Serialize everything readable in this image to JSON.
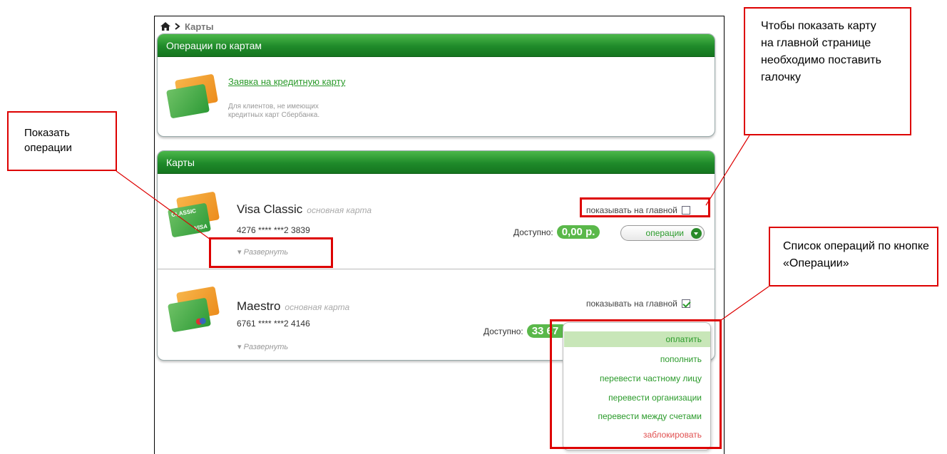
{
  "breadcrumb": {
    "current": "Карты"
  },
  "operations_panel": {
    "title": "Операции по картам",
    "apply_link": "Заявка на кредитную карту",
    "apply_note": "Для клиентов, не имеющих кредитных карт Сбербанка."
  },
  "cards_panel": {
    "title": "Карты",
    "cards": [
      {
        "name": "Visa Classic",
        "subtitle": "основная карта",
        "number": "4276 **** ***2 3839",
        "expand": "Развернуть",
        "show_main_label": "показывать на главной",
        "show_main_checked": false,
        "available_label": "Доступно:",
        "amount": "0,00 р.",
        "operations_button": "операции",
        "card_front_text": "CLASSIC",
        "card_brand_text": "VISA"
      },
      {
        "name": "Maestro",
        "subtitle": "основная карта",
        "number": "6761 **** ***2 4146",
        "expand": "Развернуть",
        "show_main_label": "показывать на главной",
        "show_main_checked": true,
        "available_label": "Доступно:",
        "amount": "33 67"
      }
    ]
  },
  "operations_menu": {
    "items": [
      "оплатить",
      "пополнить",
      "перевести частному лицу",
      "перевести организации",
      "перевести между счетами",
      "заблокировать"
    ],
    "highlighted_index": 0,
    "danger_color": "#e05050"
  },
  "annotations": {
    "show_operations": "Показать операции",
    "show_on_main": "Чтобы показать карту на главной странице необходимо поставить галочку",
    "operations_list": "Список операций по кнопке «Операции»"
  },
  "colors": {
    "accent": "#2a9a2a",
    "header_green": "#1f8a2a",
    "callout_red": "#dd0000",
    "highlight": "#c8e6b8"
  }
}
